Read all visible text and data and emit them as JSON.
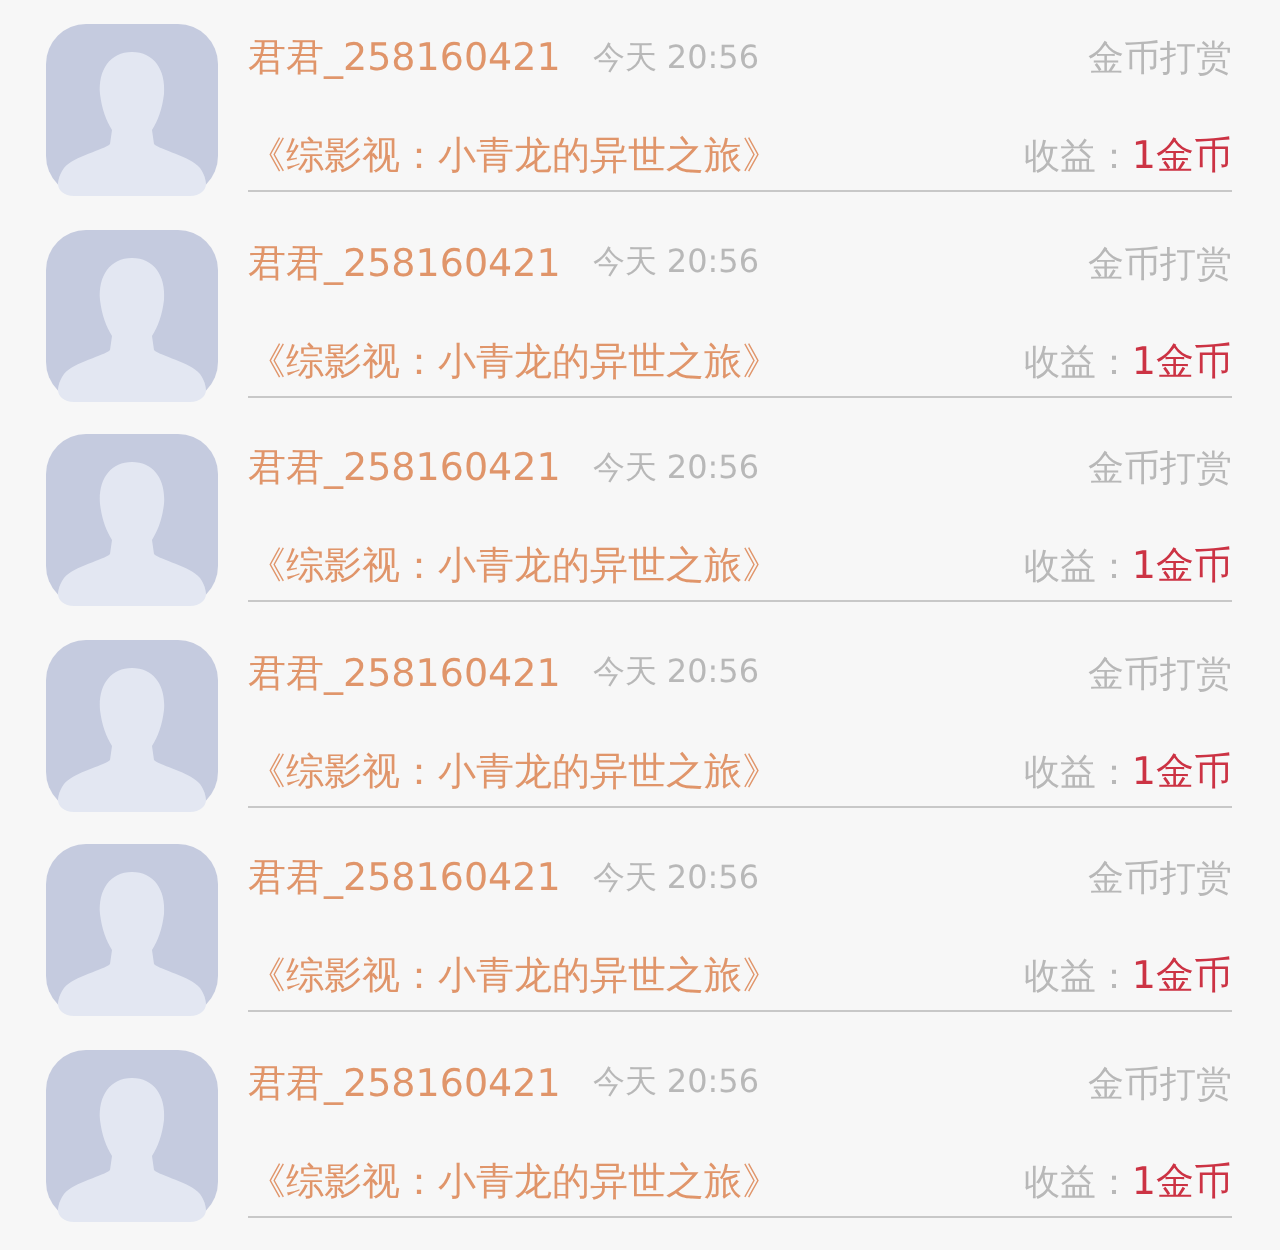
{
  "items": [
    {
      "user": "君君_258160421",
      "time": "今天 20:56",
      "type": "金币打赏",
      "book": "《综影视：小青龙的异世之旅》",
      "income_label": "收益：",
      "income": "1金币"
    },
    {
      "user": "君君_258160421",
      "time": "今天 20:56",
      "type": "金币打赏",
      "book": "《综影视：小青龙的异世之旅》",
      "income_label": "收益：",
      "income": "1金币"
    },
    {
      "user": "君君_258160421",
      "time": "今天 20:56",
      "type": "金币打赏",
      "book": "《综影视：小青龙的异世之旅》",
      "income_label": "收益：",
      "income": "1金币"
    },
    {
      "user": "君君_258160421",
      "time": "今天 20:56",
      "type": "金币打赏",
      "book": "《综影视：小青龙的异世之旅》",
      "income_label": "收益：",
      "income": "1金币"
    },
    {
      "user": "君君_258160421",
      "time": "今天 20:56",
      "type": "金币打赏",
      "book": "《综影视：小青龙的异世之旅》",
      "income_label": "收益：",
      "income": "1金币"
    },
    {
      "user": "君君_258160421",
      "time": "今天 20:56",
      "type": "金币打赏",
      "book": "《综影视：小青龙的异世之旅》",
      "income_label": "收益：",
      "income": "1金币"
    }
  ]
}
